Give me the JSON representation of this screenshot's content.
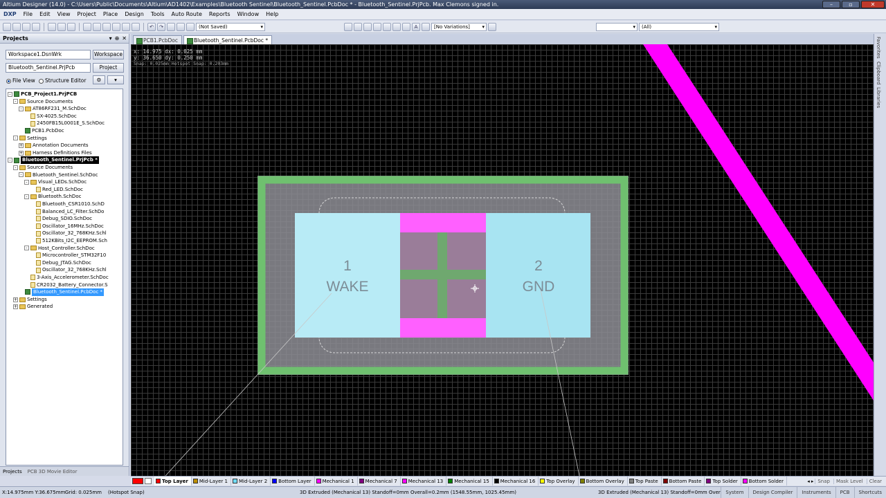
{
  "window": {
    "title": "Altium Designer (14.0) - C:\\Users\\Public\\Documents\\Altium\\AD1402\\Examples\\Bluetooth Sentinel\\Bluetooth_Sentinel.PcbDoc * - Bluetooth_Sentinel.PrjPcb. Max Clemons signed in."
  },
  "menu": [
    "DXP",
    "File",
    "Edit",
    "View",
    "Project",
    "Place",
    "Design",
    "Tools",
    "Auto Route",
    "Reports",
    "Window",
    "Help"
  ],
  "toolbar": {
    "saved_state": "(Not Saved)",
    "variations": "[No Variations]",
    "filter_all": "(All)"
  },
  "projects_panel": {
    "title": "Projects",
    "workspace_combo": "Workspace1.DsnWrk",
    "workspace_button": "Workspace",
    "project_field": "Bluetooth_Sentinel.PrjPcb",
    "project_button": "Project",
    "view_file": "File View",
    "view_structure": "Structure Editor",
    "tree": [
      {
        "label": "PCB_Project1.PrjPCB",
        "level": 0,
        "icon": "pcb",
        "exp": "-",
        "bold": true
      },
      {
        "label": "Source Documents",
        "level": 1,
        "icon": "folder",
        "exp": "-"
      },
      {
        "label": "AT86RF231_M.SchDoc",
        "level": 2,
        "icon": "folder",
        "exp": "-"
      },
      {
        "label": "SX-4025.SchDoc",
        "level": 3,
        "icon": "sch"
      },
      {
        "label": "2450FB15L0001E_S.SchDoc",
        "level": 3,
        "icon": "sch"
      },
      {
        "label": "PCB1.PcbDoc",
        "level": 2,
        "icon": "pcb"
      },
      {
        "label": "Settings",
        "level": 1,
        "icon": "folder",
        "exp": "-"
      },
      {
        "label": "Annotation Documents",
        "level": 2,
        "icon": "folder",
        "exp": "+"
      },
      {
        "label": "Harness Definitions Files",
        "level": 2,
        "icon": "folder",
        "exp": "+"
      },
      {
        "label": "Bluetooth_Sentinel.PrjPcb *",
        "level": 0,
        "icon": "pcb",
        "exp": "-",
        "selected": true
      },
      {
        "label": "Source Documents",
        "level": 1,
        "icon": "folder",
        "exp": "-"
      },
      {
        "label": "Bluetooth_Sentinel.SchDoc",
        "level": 2,
        "icon": "folder",
        "exp": "-"
      },
      {
        "label": "Visual_LEDs.SchDoc",
        "level": 3,
        "icon": "folder",
        "exp": "-"
      },
      {
        "label": "Red_LED.SchDoc",
        "level": 4,
        "icon": "sch"
      },
      {
        "label": "Bluetooth.SchDoc",
        "level": 3,
        "icon": "folder",
        "exp": "-"
      },
      {
        "label": "Bluetooth_CSR1010.SchD",
        "level": 4,
        "icon": "sch"
      },
      {
        "label": "Balanced_LC_Filter.SchDo",
        "level": 4,
        "icon": "sch"
      },
      {
        "label": "Debug_SDIO.SchDoc",
        "level": 4,
        "icon": "sch"
      },
      {
        "label": "Oscillator_16MHz.SchDoc",
        "level": 4,
        "icon": "sch"
      },
      {
        "label": "Oscillator_32_768KHz.Schl",
        "level": 4,
        "icon": "sch"
      },
      {
        "label": "512KBits_I2C_EEPROM.Sch",
        "level": 4,
        "icon": "sch"
      },
      {
        "label": "Host_Controller.SchDoc",
        "level": 3,
        "icon": "folder",
        "exp": "-"
      },
      {
        "label": "Microcontroller_STM32F10",
        "level": 4,
        "icon": "sch"
      },
      {
        "label": "Debug_JTAG.SchDoc",
        "level": 4,
        "icon": "sch"
      },
      {
        "label": "Oscillator_32_768KHz.Schl",
        "level": 4,
        "icon": "sch"
      },
      {
        "label": "3-Axis_Accelerometer.SchDoc",
        "level": 3,
        "icon": "sch"
      },
      {
        "label": "CR2032_Battery_Connector.S",
        "level": 3,
        "icon": "sch"
      },
      {
        "label": "Bluetooth_Sentinel.PcbDoc *",
        "level": 2,
        "icon": "pcb",
        "highlight": true
      },
      {
        "label": "Settings",
        "level": 1,
        "icon": "folder",
        "exp": "+"
      },
      {
        "label": "Generated",
        "level": 1,
        "icon": "folder",
        "exp": "+"
      }
    ],
    "tabs": [
      "Projects",
      "PCB 3D Movie Editor"
    ]
  },
  "doc_tabs": [
    "PCB1.PcbDoc",
    "Bluetooth_Sentinel.PcbDoc *"
  ],
  "canvas": {
    "coord_x": "x: 14.975   dx: 0.025 mm",
    "coord_y": "y: 36.650   dy: 0.250 mm",
    "snap_info": "Snap: 0.025mm Hotspot Snap: 0.203mm",
    "pad1_number": "1",
    "pad1_net": "WAKE",
    "pad2_number": "2",
    "pad2_net": "GND"
  },
  "right_panels": [
    "Favorites",
    "Clipboard",
    "Libraries"
  ],
  "layers": [
    {
      "name": "Top Layer",
      "color": "#ff0000"
    },
    {
      "name": "Mid-Layer 1",
      "color": "#bc8e00"
    },
    {
      "name": "Mid-Layer 2",
      "color": "#70dbfa"
    },
    {
      "name": "Bottom Layer",
      "color": "#0000ff"
    },
    {
      "name": "Mechanical 1",
      "color": "#ff00ff"
    },
    {
      "name": "Mechanical 7",
      "color": "#800080"
    },
    {
      "name": "Mechanical 13",
      "color": "#ff00ff"
    },
    {
      "name": "Mechanical 15",
      "color": "#008000"
    },
    {
      "name": "Mechanical 16",
      "color": "#000000"
    },
    {
      "name": "Top Overlay",
      "color": "#ffff00"
    },
    {
      "name": "Bottom Overlay",
      "color": "#808000"
    },
    {
      "name": "Top Paste",
      "color": "#808080"
    },
    {
      "name": "Bottom Paste",
      "color": "#800000"
    },
    {
      "name": "Top Solder",
      "color": "#800080"
    },
    {
      "name": "Bottom Solder",
      "color": "#ff00ff"
    }
  ],
  "layer_bar_right": [
    "Snap",
    "Mask Level",
    "Clear"
  ],
  "status": {
    "coords": "X:14.975mm Y:36.675mm",
    "grid": "Grid: 0.025mm",
    "hotspot": "(Hotspot Snap)",
    "object_info": "3D Extruded  (Mechanical 13)  Standoff=0mm  Overall=0.2mm  (1548.55mm, 1025.45mm)",
    "object_info_short": "3D Extruded  (Mechanical 13)  Standoff=0mm  Overal",
    "buttons": [
      "System",
      "Design Compiler",
      "Instruments",
      "PCB",
      "Shortcuts"
    ]
  },
  "colors": {
    "courtyard_green": "#6fc06f",
    "pad_cyan": "#b8ebf6",
    "route_magenta": "#ff00ff",
    "component_fill": "#8e8e95"
  }
}
